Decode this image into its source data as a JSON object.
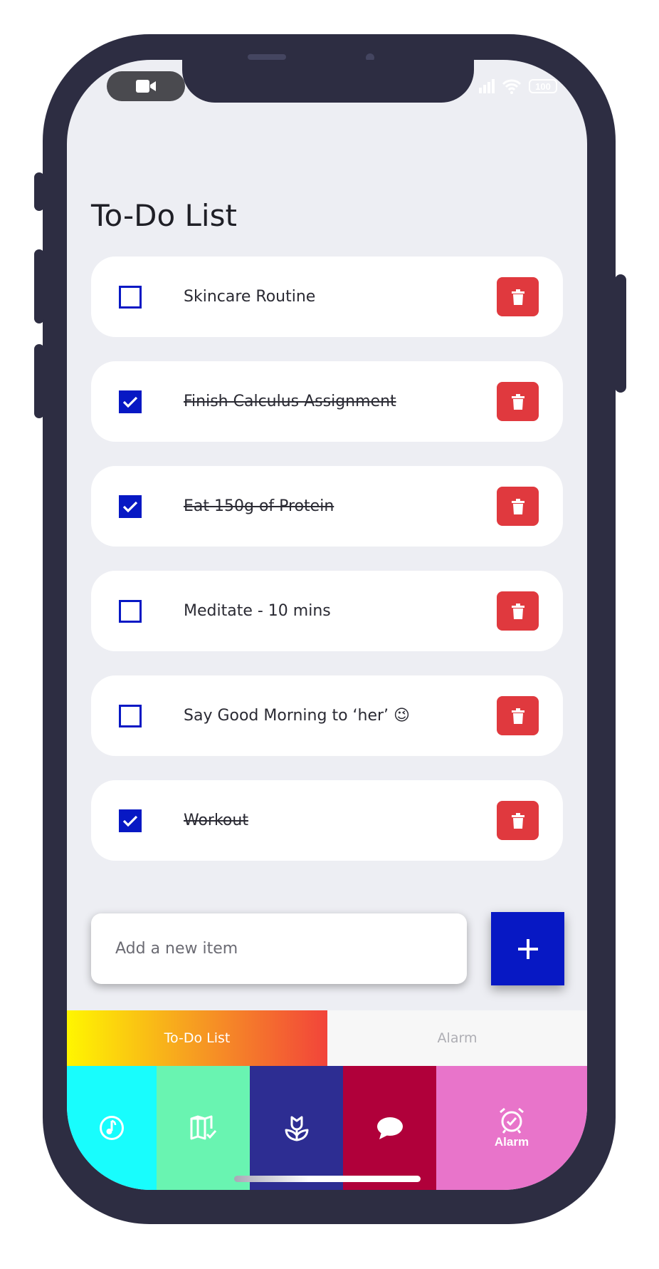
{
  "status_bar": {
    "battery": "100"
  },
  "page": {
    "title": "To-Do List"
  },
  "todos": [
    {
      "label": "Skincare Routine",
      "done": false
    },
    {
      "label": "Finish Calculus Assignment",
      "done": true
    },
    {
      "label": "Eat 150g of Protein",
      "done": true
    },
    {
      "label": "Meditate - 10 mins",
      "done": false
    },
    {
      "label": "Say Good Morning to ‘her’ 😉",
      "done": false
    },
    {
      "label": "Workout",
      "done": true
    }
  ],
  "add_item": {
    "placeholder": "Add a new item",
    "button_icon": "plus-icon"
  },
  "tabs": [
    {
      "label": "To-Do List",
      "active": true
    },
    {
      "label": "Alarm",
      "active": false
    }
  ],
  "bottom_nav": [
    {
      "icon": "music-note-icon",
      "color": "#18fdfd",
      "label": ""
    },
    {
      "icon": "map-check-icon",
      "color": "#69f4b1",
      "label": ""
    },
    {
      "icon": "flower-icon",
      "color": "#2d2d92",
      "label": ""
    },
    {
      "icon": "chat-bubble-icon",
      "color": "#b0003a",
      "label": ""
    },
    {
      "icon": "alarm-clock-icon",
      "color": "#e874ca",
      "label": "Alarm"
    }
  ],
  "colors": {
    "accent": "#0718c4",
    "delete": "#e0393e",
    "background": "#edeef3"
  }
}
